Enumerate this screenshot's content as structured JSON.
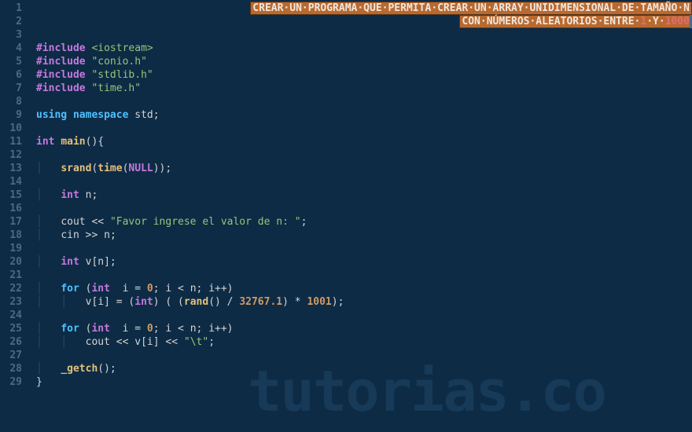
{
  "watermark": "tutorias.co",
  "comment": {
    "line1_prefix": "CREAR·UN·PROGRAMA·QUE·PERMITA·CREAR·UN·ARRAY·UNIDIMENSIONAL·DE·TAMAÑO·N",
    "line2_prefix": "CON·NÚMEROS·ALEATORIOS·ENTRE·",
    "line2_num1": "1",
    "line2_mid": "·Y·",
    "line2_num2": "1000"
  },
  "code": {
    "include": "#include",
    "iostream": "<iostream>",
    "conio": "\"conio.h\"",
    "stdlib": "\"stdlib.h\"",
    "time_h": "\"time.h\"",
    "using": "using",
    "namespace": "namespace",
    "std": "std",
    "int": "int",
    "main": "main",
    "srand": "srand",
    "time": "time",
    "null": "NULL",
    "n_decl": "n",
    "cout": "cout",
    "cin": "cin",
    "prompt": "\"Favor ingrese el valor de n: \"",
    "v_decl": "v",
    "for": "for",
    "i_decl": "i",
    "zero": "0",
    "rand": "rand",
    "divisor": "32767.1",
    "mult": "1001",
    "tab": "\"\\t\"",
    "getch": "_getch"
  },
  "line_numbers": [
    "1",
    "2",
    "3",
    "4",
    "5",
    "6",
    "7",
    "8",
    "9",
    "10",
    "11",
    "12",
    "13",
    "14",
    "15",
    "16",
    "17",
    "18",
    "19",
    "20",
    "21",
    "22",
    "23",
    "24",
    "25",
    "26",
    "27",
    "28",
    "29"
  ]
}
